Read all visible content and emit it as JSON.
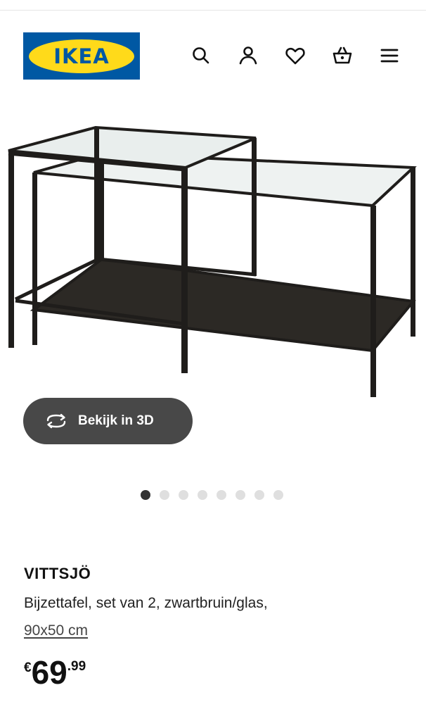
{
  "header": {
    "logo_text": "IKEA",
    "icons": [
      "search-icon",
      "user-icon",
      "heart-icon",
      "basket-icon",
      "menu-icon"
    ]
  },
  "hero": {
    "button_label": "Bekijk in 3D",
    "button_icon": "rotate-3d-icon",
    "carousel": {
      "total": 8,
      "active": 1
    }
  },
  "product": {
    "name": "VITTSJÖ",
    "description": "Bijzettafel, set van 2, zwartbruin/glas,",
    "size": "90x50 cm",
    "price_currency": "€",
    "price_integer": "69",
    "price_decimal": ".99"
  },
  "colors": {
    "brand_blue": "#0058a3",
    "brand_yellow": "#ffda1a",
    "button_bg": "#484848",
    "dot_active": "#333333",
    "dot_inactive": "#dfdfdf"
  }
}
